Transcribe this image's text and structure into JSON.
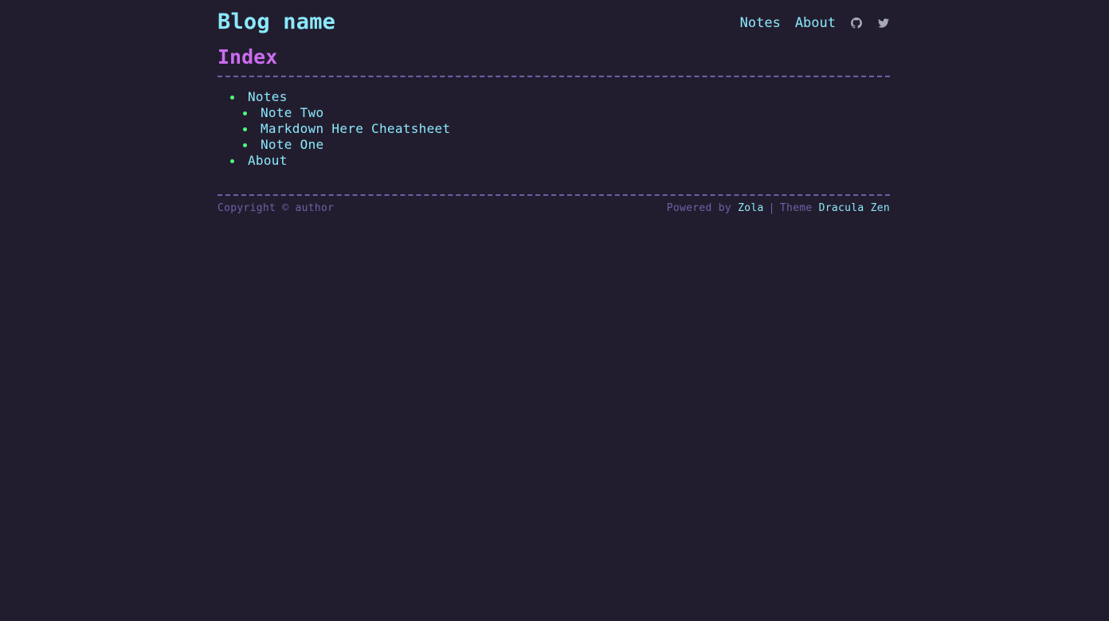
{
  "header": {
    "site_title": "Blog name",
    "nav": [
      {
        "label": "Notes"
      },
      {
        "label": "About"
      }
    ],
    "icons": [
      "github-icon",
      "twitter-icon"
    ]
  },
  "main": {
    "heading": "Index",
    "sections": [
      {
        "label": "Notes",
        "pages": [
          "Note Two",
          "Markdown Here Cheatsheet",
          "Note One"
        ]
      },
      {
        "label": "About",
        "pages": []
      }
    ]
  },
  "footer": {
    "copyright": "Copyright © author",
    "powered_by_prefix": "Powered by",
    "powered_by_link": "Zola",
    "separator": "|",
    "theme_prefix": "Theme",
    "theme_link": "Dracula Zen"
  },
  "colors": {
    "background": "#221d2e",
    "link": "#8be9fd",
    "heading": "#cc6cf0",
    "bullet": "#50fa7b",
    "muted": "#6b62a8"
  }
}
